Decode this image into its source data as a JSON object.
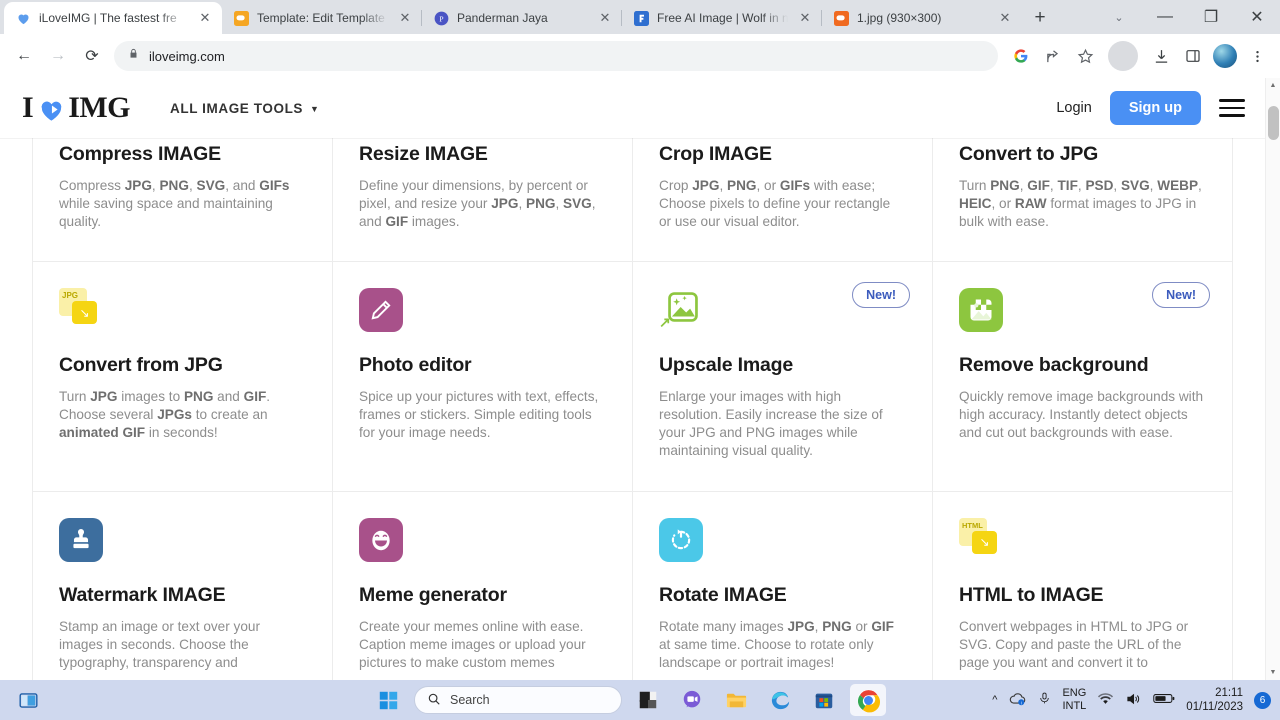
{
  "browser": {
    "tabs": [
      {
        "title": "iLoveIMG | The fastest fre",
        "favicon": "iloveimg-heart-icon",
        "active": true
      },
      {
        "title": "Template: Edit Template",
        "favicon": "blogger-icon",
        "active": false
      },
      {
        "title": "Panderman Jaya",
        "favicon": "panderman-icon",
        "active": false
      },
      {
        "title": "Free AI Image | Wolf in n",
        "favicon": "freepik-icon",
        "active": false
      },
      {
        "title": "1.jpg (930×300)",
        "favicon": "blogger-orange-icon",
        "active": false
      }
    ],
    "new_tab_label": "+",
    "window_controls": {
      "chevron": "⌄",
      "minimize": "—",
      "maximize": "❐",
      "close": "✕"
    },
    "omnibox": {
      "url": "iloveimg.com",
      "lock": "lock-icon"
    },
    "nav": {
      "back": "←",
      "forward": "→",
      "reload": "⟳"
    },
    "toolbar_icons": [
      "google-icon",
      "share-icon",
      "bookmark-star-icon",
      "downloads-icon",
      "side-panel-icon",
      "profile-avatar-icon",
      "chrome-menu-icon"
    ]
  },
  "site": {
    "logo": {
      "text_before": "I",
      "text_after": "IMG",
      "heart": "heart-icon"
    },
    "nav_tools_label": "ALL IMAGE TOOLS",
    "nav_caret": "▼",
    "login_label": "Login",
    "signup_label": "Sign up",
    "menu": "hamburger-menu-icon",
    "accent_color": "#4a90f4"
  },
  "tools": [
    {
      "title": "Compress IMAGE",
      "desc_html": "Compress <b>JPG</b>, <b>PNG</b>, <b>SVG</b>, and <b>GIFs</b> while saving space and maintaining quality.",
      "icon": "compress-arrows-icon",
      "icon_color": "#8dc63f",
      "badge": ""
    },
    {
      "title": "Resize IMAGE",
      "desc_html": "Define your dimensions, by percent or pixel, and resize your <b>JPG</b>, <b>PNG</b>, <b>SVG</b>, and <b>GIF</b> images.",
      "icon": "resize-image-icon",
      "icon_color": "#4bc8e8",
      "badge": ""
    },
    {
      "title": "Crop IMAGE",
      "desc_html": "Crop <b>JPG</b>, <b>PNG</b>, or <b>GIFs</b> with ease; Choose pixels to define your rectangle or use our visual editor.",
      "icon": "crop-icon",
      "icon_color": "#4bc8e8",
      "badge": ""
    },
    {
      "title": "Convert to JPG",
      "desc_html": "Turn <b>PNG</b>, <b>GIF</b>, <b>TIF</b>, <b>PSD</b>, <b>SVG</b>, <b>WEBP</b>, <b>HEIC</b>, or <b>RAW</b> format images to JPG in bulk with ease.",
      "icon": "jpg-file-icon",
      "icon_color": "#f5dd28",
      "badge": ""
    },
    {
      "title": "Convert from JPG",
      "desc_html": "Turn <b>JPG</b> images to <b>PNG</b> and <b>GIF</b>. Choose several <b>JPGs</b> to create an <b>animated GIF</b> in seconds!",
      "icon": "jpg-convert-from-icon",
      "icon_color": "#f5dd28",
      "badge": ""
    },
    {
      "title": "Photo editor",
      "desc_html": "Spice up your pictures with text, effects, frames or stickers. Simple editing tools for your image needs.",
      "icon": "pencil-edit-icon",
      "icon_color": "#a8518a",
      "badge": ""
    },
    {
      "title": "Upscale Image",
      "desc_html": "Enlarge your images with high resolution. Easily increase the size of your JPG and PNG images while maintaining visual quality.",
      "icon": "upscale-image-icon",
      "icon_color": "#8dc63f",
      "badge": "New!"
    },
    {
      "title": "Remove background",
      "desc_html": "Quickly remove image backgrounds with high accuracy. Instantly detect objects and cut out backgrounds with ease.",
      "icon": "remove-background-icon",
      "icon_color": "#8dc63f",
      "badge": "New!"
    },
    {
      "title": "Watermark IMAGE",
      "desc_html": "Stamp an image or text over your images in seconds. Choose the typography, transparency and",
      "icon": "watermark-stamp-icon",
      "icon_color": "#3d6e9e",
      "badge": ""
    },
    {
      "title": "Meme generator",
      "desc_html": "Create your memes online with ease. Caption meme images or upload your pictures to make custom memes",
      "icon": "meme-face-icon",
      "icon_color": "#a8518a",
      "badge": ""
    },
    {
      "title": "Rotate IMAGE",
      "desc_html": "Rotate many images <b>JPG</b>, <b>PNG</b> or <b>GIF</b> at same time. Choose to rotate only landscape or portrait images!",
      "icon": "rotate-icon",
      "icon_color": "#4bc8e8",
      "badge": ""
    },
    {
      "title": "HTML to IMAGE",
      "desc_html": "Convert webpages in HTML to JPG or SVG. Copy and paste the URL of the page you want and convert it to",
      "icon": "html-to-image-icon",
      "icon_color": "#f5dd28",
      "badge": ""
    }
  ],
  "taskbar": {
    "task_view": "task-view-icon",
    "start": "windows-start-icon",
    "search_placeholder": "Search",
    "search_icon": "search-icon",
    "apps": [
      {
        "name": "file-explorer-dark-icon"
      },
      {
        "name": "messenger-icon"
      },
      {
        "name": "file-explorer-icon"
      },
      {
        "name": "microsoft-edge-icon"
      },
      {
        "name": "microsoft-store-icon"
      },
      {
        "name": "google-chrome-icon"
      }
    ],
    "tray": {
      "chevron": "^",
      "onedrive": "onedrive-icon",
      "mic": "microphone-icon",
      "language_line1": "ENG",
      "language_line2": "INTL",
      "wifi": "wifi-icon",
      "volume": "volume-icon",
      "battery": "battery-icon",
      "time": "21:11",
      "date": "01/11/2023",
      "notification_count": "6"
    }
  }
}
